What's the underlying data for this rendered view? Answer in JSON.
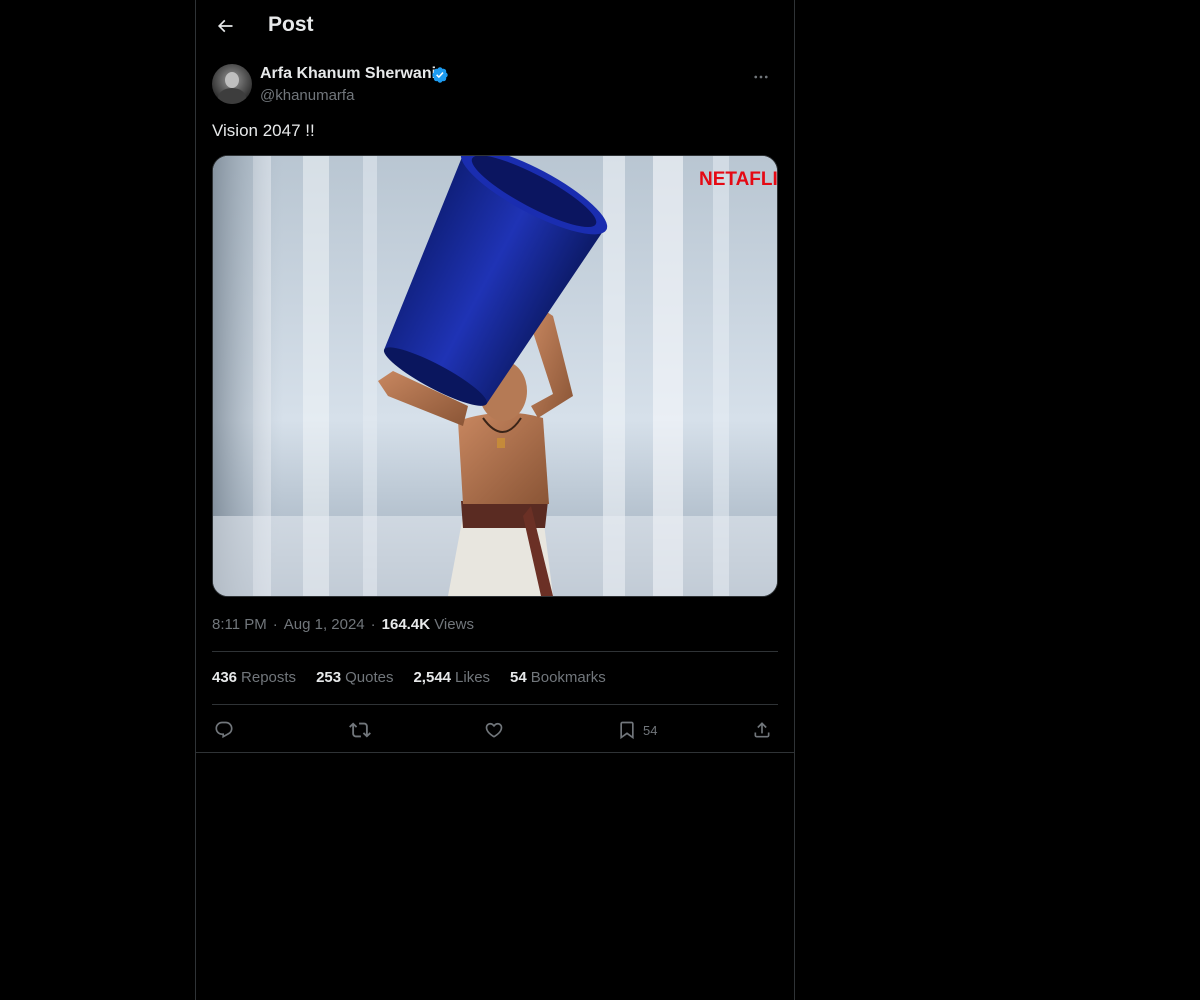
{
  "header": {
    "title": "Post",
    "back_icon": "arrow-left-icon"
  },
  "post": {
    "author": {
      "display_name": "Arfa Khanum Sherwani",
      "handle": "@khanumarfa",
      "verified": true,
      "verified_color": "#1d9bf0"
    },
    "text": "Vision 2047 !!",
    "media": {
      "watermark": "NETAFLIX",
      "watermark_color": "#e50914"
    },
    "timestamp": {
      "time": "8:11 PM",
      "date": "Aug 1, 2024",
      "views_count": "164.4K",
      "views_label": "Views"
    },
    "stats": [
      {
        "value": "436",
        "label": "Reposts"
      },
      {
        "value": "253",
        "label": "Quotes"
      },
      {
        "value": "2,544",
        "label": "Likes"
      },
      {
        "value": "54",
        "label": "Bookmarks"
      }
    ],
    "actions": {
      "reply_icon": "reply-icon",
      "repost_icon": "repost-icon",
      "like_icon": "like-icon",
      "bookmark_icon": "bookmark-icon",
      "bookmark_count": "54",
      "share_icon": "share-icon"
    }
  },
  "colors": {
    "background": "#000000",
    "text_primary": "#e7e9ea",
    "text_secondary": "#71767b",
    "border": "#2f3336",
    "accent": "#1d9bf0"
  }
}
